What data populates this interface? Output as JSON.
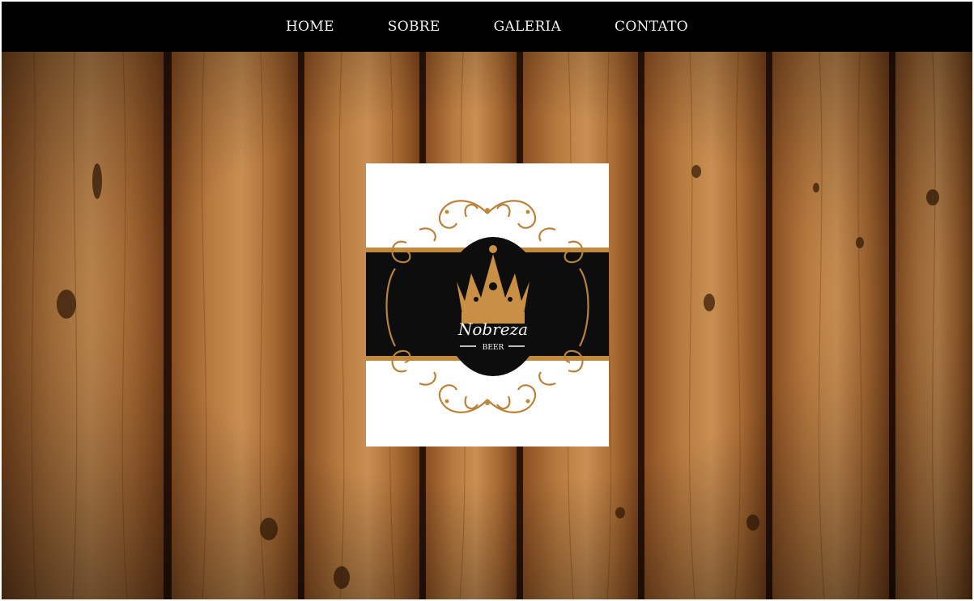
{
  "nav": {
    "items": [
      {
        "label": "HOME"
      },
      {
        "label": "SOBRE"
      },
      {
        "label": "GALERIA"
      },
      {
        "label": "CONTATO"
      }
    ]
  },
  "logo": {
    "brand": "Nobreza",
    "sub": "BEER"
  },
  "colors": {
    "nav_bg": "#000000",
    "nav_text": "#f2f2f2",
    "gold": "#c08a3e",
    "wood_light": "#b87a3e",
    "wood_dark": "#3b1d0a"
  }
}
